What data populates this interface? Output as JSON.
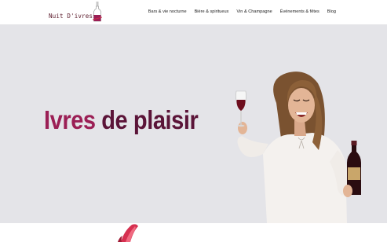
{
  "brand": {
    "name": "Nuit D'ivresse"
  },
  "nav": {
    "items": [
      {
        "label": "Bars & vie nocturne"
      },
      {
        "label": "Bière & spiritueux"
      },
      {
        "label": "Vin & Champagne"
      },
      {
        "label": "Événements & fêtes"
      },
      {
        "label": "Blog"
      }
    ]
  },
  "hero": {
    "title_word1": "Ivres",
    "title_word2": "de plaisir",
    "image": "woman-with-wine-glass-and-bottle"
  },
  "colors": {
    "accent": "#9b1f55",
    "accent_dark": "#5b1438",
    "hero_bg": "#e4e4e8"
  }
}
